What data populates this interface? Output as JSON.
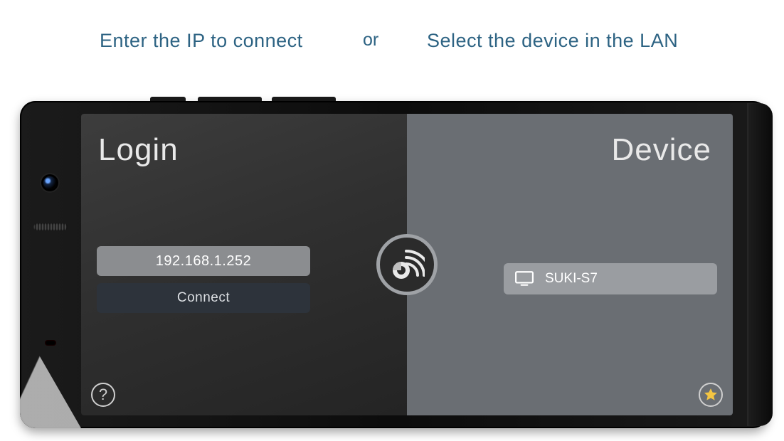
{
  "captions": {
    "left": "Enter the IP to connect",
    "or": "or",
    "right": "Select the device in the LAN"
  },
  "login": {
    "title": "Login",
    "ip_value": "192.168.1.252",
    "connect_label": "Connect"
  },
  "device": {
    "title": "Device",
    "items": [
      {
        "name": "SUKI-S7"
      }
    ]
  },
  "icons": {
    "help": "?",
    "star": "star-icon",
    "cast": "cast-icon",
    "monitor": "monitor-icon"
  }
}
